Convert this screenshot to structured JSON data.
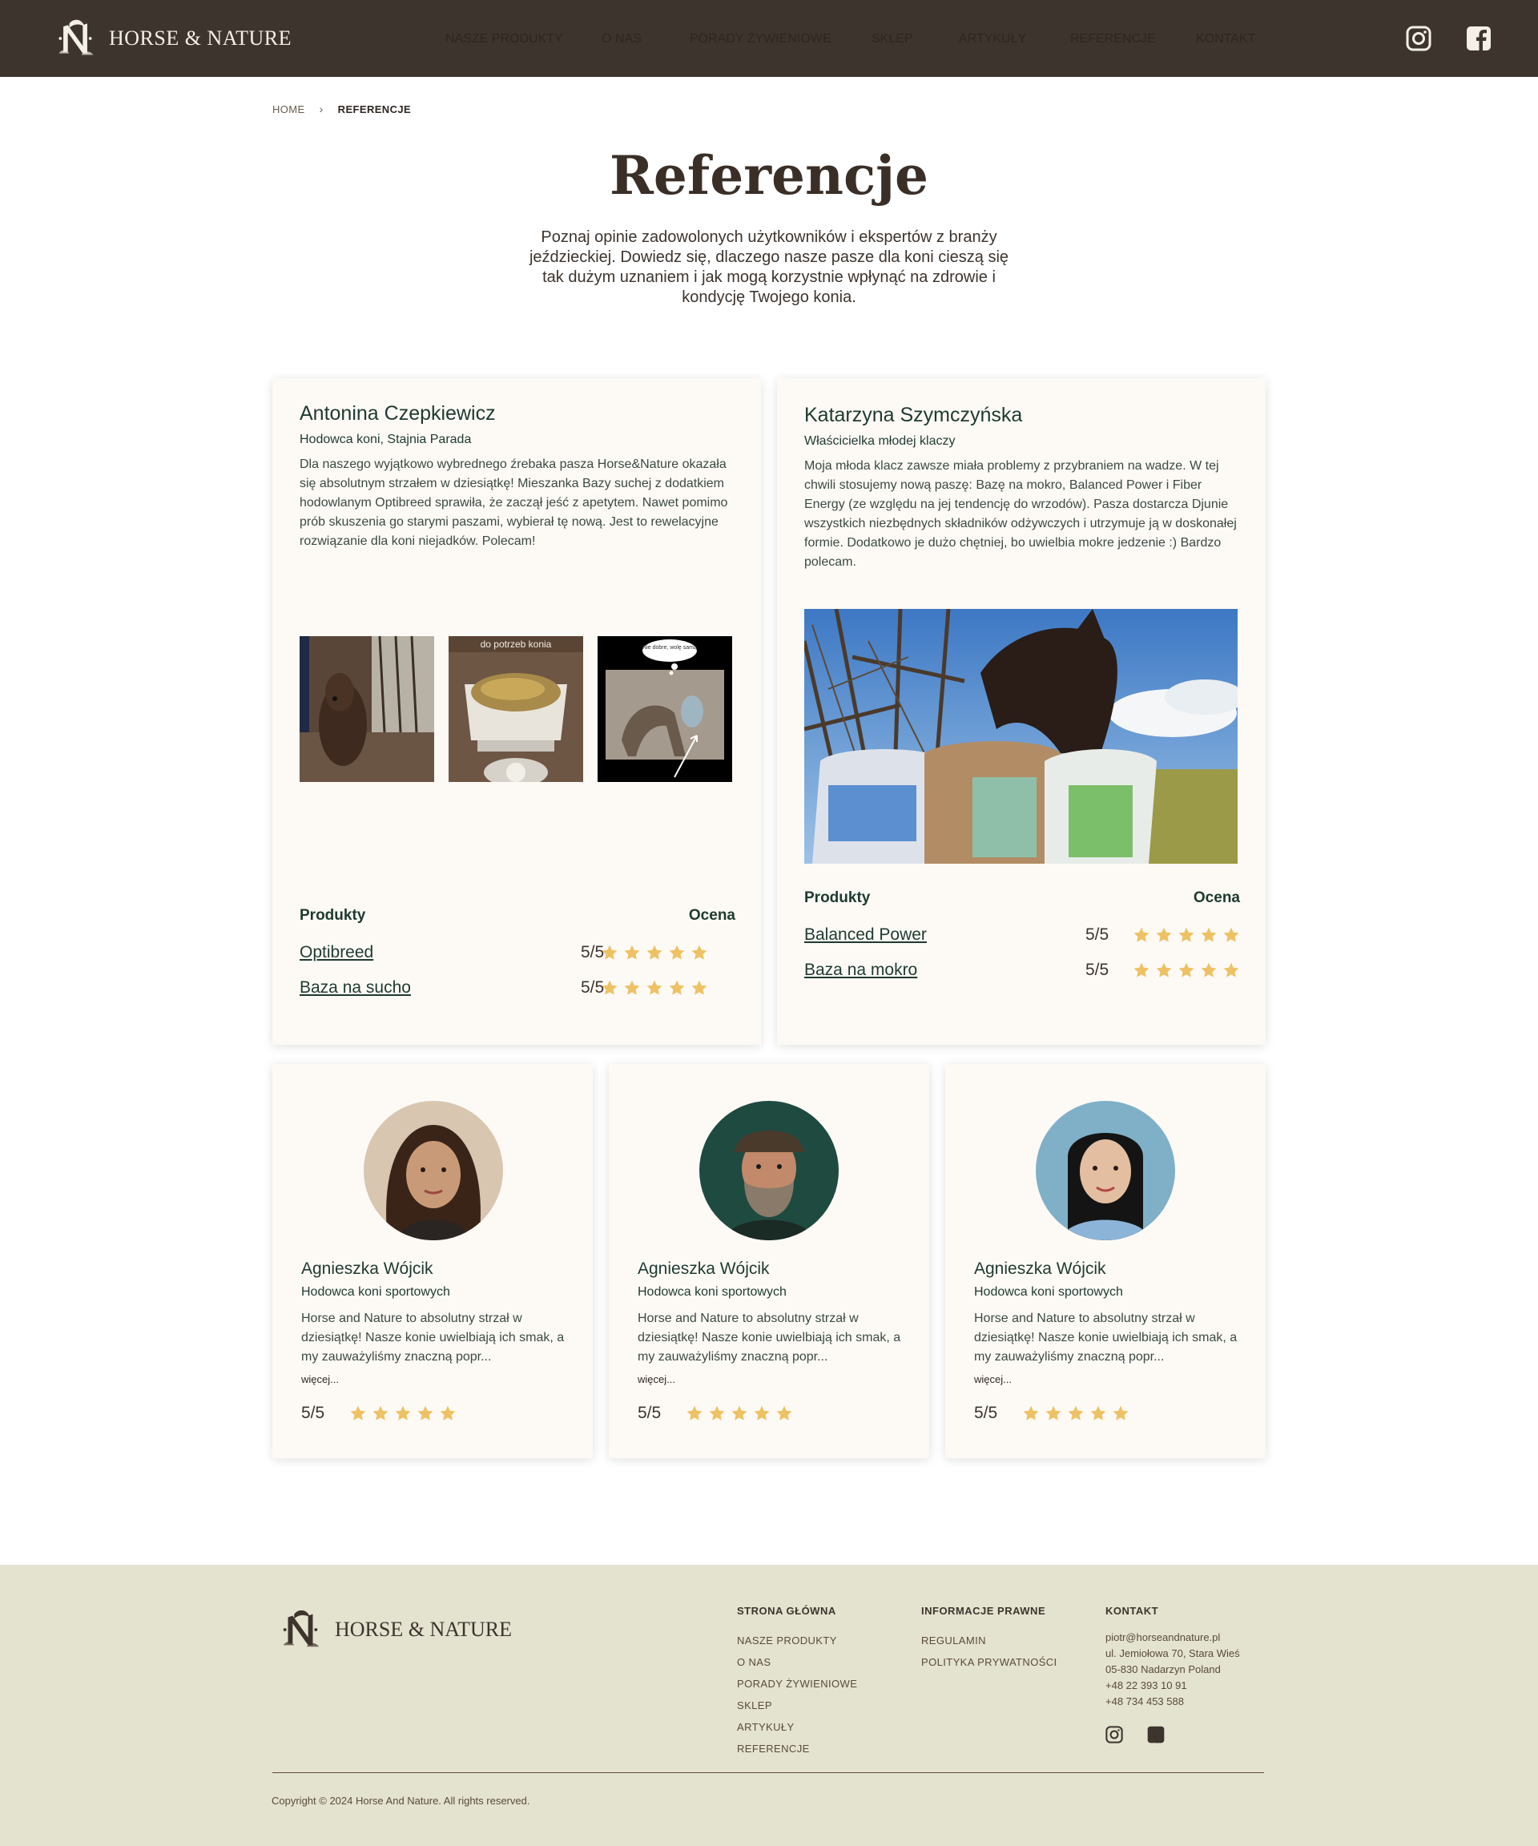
{
  "header": {
    "brand": "HORSE & NATURE",
    "nav": [
      "NASZE PRODUKTY",
      "O NAS",
      "PORADY ŻYWIENIOWE",
      "SKLEP",
      "ARTYKUŁY",
      "REFERENCJE",
      "KONTAKT"
    ],
    "social_icons": [
      "instagram-icon",
      "facebook-icon"
    ]
  },
  "breadcrumb": {
    "home": "HOME",
    "current": "REFERENCJE"
  },
  "page": {
    "title": "Referencje",
    "intro": "Poznaj opinie zadowolonych użytkowników i ekspertów z branży jeździeckiej. Dowiedz się, dlaczego nasze pasze dla koni cieszą się tak dużym uznaniem i jak mogą korzystnie wpłynąć na zdrowie i kondycję Twojego konia."
  },
  "featured": [
    {
      "name": "Antonina Czepkiewicz",
      "role": "Hodowca koni, Stajnia Parada",
      "text": "Dla naszego wyjątkowo wybrednego źrebaka pasza Horse&Nature okazała się absolutnym strzałem w dziesiątkę! Mieszanka Bazy suchej z dodatkiem hodowlanym Optibreed sprawiła, że zaczął jeść z apetytem. Nawet pomimo prób skuszenia go starymi paszami, wybierał tę nową. Jest to rewelacyjne rozwiązanie dla koni niejadków. Polecam!",
      "thumb_captions": [
        "do potrzeb konia",
        "Nie dobre, wolę samą"
      ],
      "products_label": "Produkty",
      "rating_label": "Ocena",
      "products": [
        {
          "name": "Optibreed",
          "score": "5/5",
          "stars": 5
        },
        {
          "name": "Baza na sucho",
          "score": "5/5",
          "stars": 5
        }
      ]
    },
    {
      "name": "Katarzyna Szymczyńska",
      "role": "Właścicielka młodej klaczy",
      "text": "Moja młoda klacz zawsze miała problemy z przybraniem na wadze. W tej chwili stosujemy nową paszę: Bazę na mokro, Balanced Power i Fiber Energy (ze względu na jej tendencję do wrzodów). Pasza dostarcza Djunie wszystkich niezbędnych składników odżywczych i utrzymuje ją w doskonałej formie. Dodatkowo je dużo chętniej, bo uwielbia mokre jedzenie :) Bardzo polecam.",
      "products_label": "Produkty",
      "rating_label": "Ocena",
      "products": [
        {
          "name": "Balanced Power",
          "score": "5/5",
          "stars": 5
        },
        {
          "name": "Baza na mokro",
          "score": "5/5",
          "stars": 5
        }
      ]
    }
  ],
  "small": [
    {
      "name": "Agnieszka Wójcik",
      "role": "Hodowca koni sportowych",
      "text": "Horse and Nature to absolutny strzał w dziesiątkę! Nasze konie uwielbiają ich smak, a my zauważyliśmy znaczną popr...",
      "more": "więcej...",
      "score": "5/5",
      "stars": 5
    },
    {
      "name": "Agnieszka Wójcik",
      "role": "Hodowca koni sportowych",
      "text": "Horse and Nature to absolutny strzał w dziesiątkę! Nasze konie uwielbiają ich smak, a my zauważyliśmy znaczną popr...",
      "more": "więcej...",
      "score": "5/5",
      "stars": 5
    },
    {
      "name": "Agnieszka Wójcik",
      "role": "Hodowca koni sportowych",
      "text": "Horse and Nature to absolutny strzał w dziesiątkę! Nasze konie uwielbiają ich smak, a my zauważyliśmy znaczną popr...",
      "more": "więcej...",
      "score": "5/5",
      "stars": 5
    }
  ],
  "footer": {
    "brand": "HORSE & NATURE",
    "col1": {
      "title": "STRONA GŁÓWNA",
      "links": [
        "NASZE PRODUKTY",
        "O NAS",
        "PORADY ŻYWIENIOWE",
        "SKLEP",
        "ARTYKUŁY",
        "REFERENCJE"
      ]
    },
    "col2": {
      "title": "INFORMACJE PRAWNE",
      "links": [
        "REGULAMIN",
        "POLITYKA PRYWATNOŚCI"
      ]
    },
    "col3": {
      "title": "KONTAKT",
      "lines": [
        "piotr@horseandnature.pl",
        "ul. Jemiołowa 70, Stara Wieś",
        "05-830 Nadarzyn Poland",
        "+48 22 393 10 91",
        "+48 734 453 588"
      ]
    },
    "copyright": "Copyright © 2024 Horse And Nature. All rights reserved."
  },
  "colors": {
    "header_bg": "#3d342d",
    "footer_bg": "#e4e3cf",
    "card_bg": "#fdfaf6",
    "star": "#eec264",
    "text_green": "#1f3a30"
  }
}
